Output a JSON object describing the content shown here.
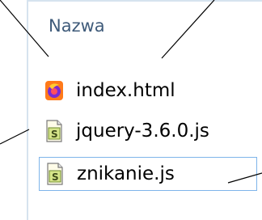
{
  "header": {
    "column": "Nazwa"
  },
  "files": [
    {
      "name": "index.html",
      "icon": "firefox-html-icon"
    },
    {
      "name": "jquery-3.6.0.js",
      "icon": "script-file-icon"
    },
    {
      "name": "znikanie.js",
      "icon": "script-file-icon",
      "selected": true
    }
  ],
  "colors": {
    "header_text": "#3f5b7a",
    "selection_border": "#7eb4ea",
    "panel_border": "#d6e3ef"
  }
}
